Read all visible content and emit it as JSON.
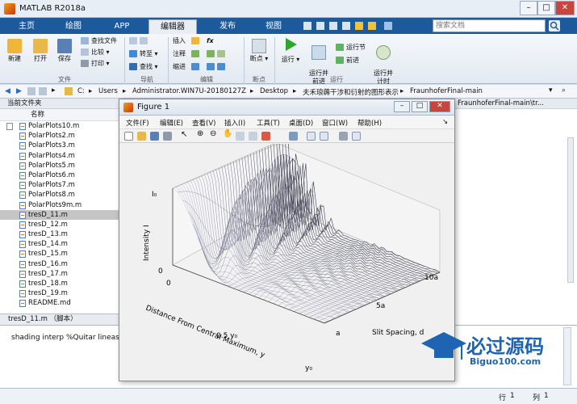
{
  "window": {
    "title": "MATLAB R2018a"
  },
  "tabs": [
    "主页",
    "绘图",
    "APP",
    "编辑器",
    "发布",
    "视图"
  ],
  "search": {
    "placeholder": "搜索文档"
  },
  "ribbon": {
    "file": {
      "new": "新建",
      "open": "打开",
      "save": "保存",
      "find_files": "查找文件",
      "compare": "比较",
      "print": "打印",
      "group": "文件"
    },
    "nav": {
      "goto": "转至",
      "find": "查找",
      "group": "导航"
    },
    "edit": {
      "insert": "插入",
      "comment": "注释",
      "indent": "缩进",
      "fx": "fx",
      "group": "编辑"
    },
    "breakpoints": {
      "label": "断点",
      "group": "断点"
    },
    "run": {
      "run": "运行",
      "run_advance": "运行并\n前进",
      "run_section": "运行节",
      "advance": "前进",
      "run_time": "运行并\n计时",
      "group": "运行"
    }
  },
  "address": {
    "crumbs": [
      "C:",
      "Users",
      "Administrator.WIN7U-20180127Z",
      "Desktop",
      "夫禾琅薅干涉和衍射的图形表示",
      "FraunhoferFinal-main"
    ]
  },
  "current_folder": {
    "title": "当前文件夹",
    "col_header": "名称",
    "files": [
      "PolarPlots10.m",
      "PolarPlots2.m",
      "PolarPlots3.m",
      "PolarPlots4.m",
      "PolarPlots5.m",
      "PolarPlots6.m",
      "PolarPlots7.m",
      "PolarPlots8.m",
      "PolarPlots9m.m",
      "tresD_11.m",
      "tresD_12.m",
      "tresD_13.m",
      "tresD_14.m",
      "tresD_15.m",
      "tresD_16.m",
      "tresD_17.m",
      "tresD_18.m",
      "tresD_19.m",
      "README.md"
    ],
    "selected_index": 9,
    "details": "tresD_11.m （脚本）"
  },
  "right_panel": {
    "path_fragment": "FraunhoferFinal-main\\tr..."
  },
  "command": {
    "text": "shading interp %Quitar lineas"
  },
  "status": {
    "row_label": "行",
    "row": "1",
    "col_label": "列",
    "col": "1"
  },
  "figure": {
    "title": "Figure 1",
    "menu": [
      "文件(F)",
      "编辑(E)",
      "查看(V)",
      "插入(I)",
      "工具(T)",
      "桌面(D)",
      "窗口(W)",
      "帮助(H)"
    ],
    "axes": {
      "z_label": "Intensity I",
      "z_top": "I₀",
      "z_zero": "0",
      "x_label": "Distance From Central Maximum, y",
      "x_zero": "0",
      "x_mid": "0.5 y₀",
      "x_end": "y₀",
      "y_label": "Slit Spacing, d",
      "y_ticks": [
        "a",
        "5a",
        "10a"
      ]
    }
  },
  "watermark": {
    "text": "必过源码",
    "url": "Biguo100.com"
  },
  "colors": {
    "tabbar": "#1c5a9c",
    "accent": "#2b6cb3",
    "surface_dark": "#3a3c48",
    "surface_light": "#e9ecf3"
  }
}
